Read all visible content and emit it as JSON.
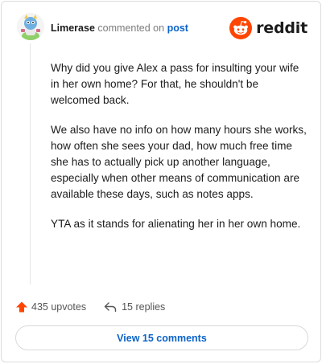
{
  "comment": {
    "author": "Limerase",
    "action_text": "commented on",
    "post_link_text": "post",
    "paragraphs": [
      "Why did you give Alex a pass for insulting your wife in her own home? For that, he shouldn't be welcomed back.",
      "We also have no info on how many hours she works, how often she sees your dad, how much free time she has to actually pick up another language, especially when other means of communication are available these days, such as notes apps.",
      "YTA as it stands for alienating her in her own home."
    ]
  },
  "brand": {
    "name": "reddit",
    "icon": "reddit-snoo-icon",
    "color": "#ff4500"
  },
  "stats": {
    "upvotes_label": "435 upvotes",
    "upvote_icon": "upvote-arrow-icon",
    "upvote_color": "#ff4500",
    "replies_label": "15 replies",
    "reply_icon": "reply-arrow-icon"
  },
  "footer": {
    "view_comments_label": "View 15 comments"
  },
  "colors": {
    "link": "#0b63c8",
    "muted": "#7c7c7c"
  }
}
